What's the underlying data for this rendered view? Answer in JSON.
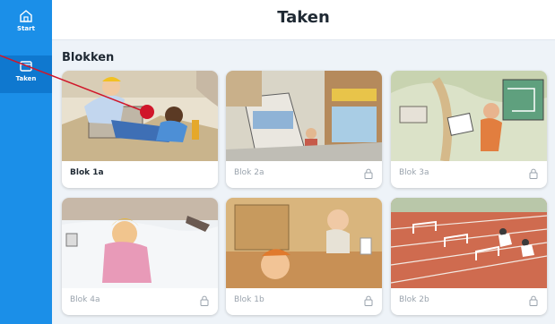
{
  "sidebar": {
    "items": [
      {
        "label": "Start",
        "icon": "home-icon"
      },
      {
        "label": "Taken",
        "icon": "tasks-icon"
      }
    ]
  },
  "header": {
    "title": "Taken"
  },
  "section": {
    "title": "Blokken"
  },
  "cards": [
    {
      "label": "Blok 1a",
      "locked": false
    },
    {
      "label": "Blok 2a",
      "locked": true
    },
    {
      "label": "Blok 3a",
      "locked": true
    },
    {
      "label": "Blok 4a",
      "locked": true
    },
    {
      "label": "Blok 1b",
      "locked": true
    },
    {
      "label": "Blok 2b",
      "locked": true
    }
  ],
  "colors": {
    "accent": "#1b8fe8",
    "pointer": "#d0162a"
  }
}
